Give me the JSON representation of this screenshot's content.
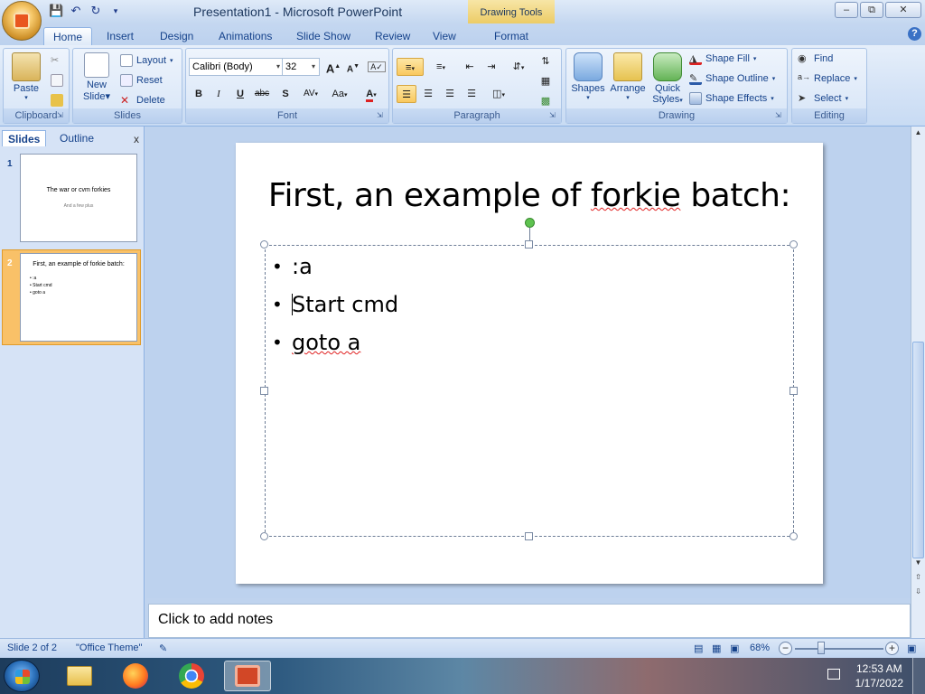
{
  "window": {
    "title": "Presentation1 - Microsoft PowerPoint",
    "contextual_tab_group": "Drawing Tools",
    "controls": [
      "minimize",
      "restore",
      "close"
    ]
  },
  "tabs": [
    "Home",
    "Insert",
    "Design",
    "Animations",
    "Slide Show",
    "Review",
    "View",
    "Format"
  ],
  "active_tab": "Home",
  "ribbon": {
    "clipboard": {
      "label": "Clipboard",
      "paste": "Paste"
    },
    "slides": {
      "label": "Slides",
      "new_slide_1": "New",
      "new_slide_2": "Slide",
      "layout": "Layout",
      "reset": "Reset",
      "delete": "Delete"
    },
    "font": {
      "label": "Font",
      "font_name": "Calibri (Body)",
      "font_size": "32",
      "bold": "B",
      "italic": "I",
      "underline": "U",
      "strike": "abc",
      "shadow": "S",
      "spacing": "AV",
      "case": "Aa",
      "color": "A",
      "grow": "A",
      "shrink": "A"
    },
    "paragraph": {
      "label": "Paragraph"
    },
    "drawing": {
      "label": "Drawing",
      "shapes": "Shapes",
      "arrange": "Arrange",
      "quick_styles_1": "Quick",
      "quick_styles_2": "Styles",
      "shape_fill": "Shape Fill",
      "shape_outline": "Shape Outline",
      "shape_effects": "Shape Effects"
    },
    "editing": {
      "label": "Editing",
      "find": "Find",
      "replace": "Replace",
      "select": "Select"
    }
  },
  "slide_panel": {
    "tabs": [
      "Slides",
      "Outline"
    ],
    "close": "x",
    "slides": [
      {
        "num": "1",
        "title": "The war or cvm forkies",
        "subtitle": "And a few plus",
        "selected": false
      },
      {
        "num": "2",
        "title": "First, an example of forkie batch:",
        "bullets": [
          ":a",
          "Start cmd",
          "goto a"
        ],
        "selected": true
      }
    ]
  },
  "slide": {
    "title_pre": "First, an example of ",
    "title_spell": "forkie",
    "title_post": " batch:",
    "bullets": [
      ":a",
      "Start cmd",
      "goto a"
    ]
  },
  "notes": {
    "placeholder": "Click to add notes"
  },
  "status": {
    "slide_count": "Slide 2 of 2",
    "theme": "\"Office Theme\"",
    "zoom": "68%",
    "zoom_minus": "−",
    "zoom_plus": "+"
  },
  "taskbar": {
    "apps": [
      "file-explorer",
      "firefox",
      "chrome",
      "powerpoint"
    ],
    "time": "12:53 AM",
    "date": "1/17/2022"
  },
  "colors": {
    "ribbon_bg": "#d3e2f6",
    "accent_selected_thumb": "#f9c168",
    "spellcheck": "#e02020",
    "rotate_handle": "#5ec24f"
  }
}
